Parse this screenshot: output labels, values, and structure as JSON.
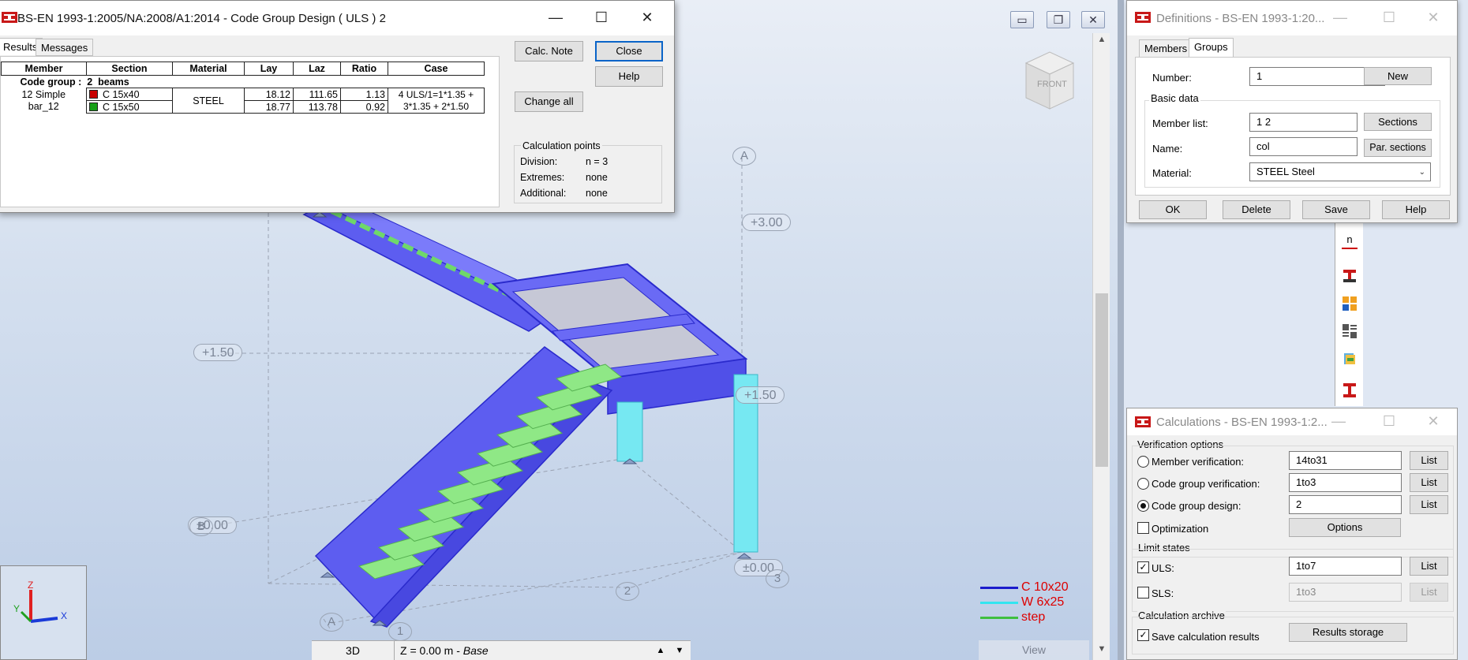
{
  "viewport": {
    "level_labels": [
      "+3.00",
      "+1.50",
      "+1.50",
      "±0.00",
      "±0.00"
    ],
    "grid_labels": [
      "A",
      "A",
      "1",
      "2",
      "3",
      "B"
    ],
    "nav_cube_label": "FRONT",
    "controls": {
      "minimize": "▭",
      "restore": "❐",
      "close": "✕"
    },
    "bottom_bar": {
      "mode": "3D",
      "level_text": "Z = 0.00 m - ",
      "level_name": "Base",
      "up": "▲",
      "down": "▼"
    },
    "view_button": "View",
    "axes": {
      "z": "Z",
      "y": "Y",
      "x": "X"
    },
    "legend": [
      {
        "label": "C 10x20",
        "color": "#1b1bcc"
      },
      {
        "label": "W 6x25",
        "color": "#33e5f0"
      },
      {
        "label": "step",
        "color": "#3fbf3f"
      }
    ],
    "colors": {
      "frame": "#6060f0",
      "step": "#8fe886",
      "column": "#6ee8f2",
      "slab": "#c8cad8"
    }
  },
  "code_group_dialog": {
    "title": "BS-EN 1993-1:2005/NA:2008/A1:2014 - Code Group Design ( ULS ) 2",
    "tabs": [
      "Results",
      "Messages"
    ],
    "columns": [
      "Member",
      "Section",
      "Material",
      "Lay",
      "Laz",
      "Ratio",
      "Case"
    ],
    "group_label": "Code group :",
    "group_number": "2",
    "group_name": "beams",
    "member": {
      "line1": "12  Simple",
      "line2": "bar_12"
    },
    "material": "STEEL",
    "rows": [
      {
        "section": "C 15x40",
        "lay": "18.12",
        "laz": "111.65",
        "ratio": "1.13",
        "status_color": "#c80000"
      },
      {
        "section": "C 15x50",
        "lay": "18.77",
        "laz": "113.78",
        "ratio": "0.92",
        "status_color": "#18a018"
      }
    ],
    "case": {
      "line1": "4 ULS/1=1*1.35 +",
      "line2": "3*1.35 + 2*1.50"
    },
    "buttons": {
      "calc_note": "Calc. Note",
      "close": "Close",
      "help": "Help",
      "change_all": "Change all"
    },
    "calc_points": {
      "title": "Calculation points",
      "division_label": "Division:",
      "division_value": "n = 3",
      "extremes_label": "Extremes:",
      "extremes_value": "none",
      "additional_label": "Additional:",
      "additional_value": "none"
    }
  },
  "definitions_dialog": {
    "title": "Definitions - BS-EN 1993-1:20...",
    "tabs": [
      "Members",
      "Groups"
    ],
    "number_label": "Number:",
    "number_value": "1",
    "new_button": "New",
    "basic_data": "Basic data",
    "member_list_label": "Member list:",
    "member_list_value": "1 2",
    "sections_button": "Sections",
    "name_label": "Name:",
    "name_value": "col",
    "par_sections_button": "Par. sections",
    "material_label": "Material:",
    "material_value": "STEEL Steel",
    "buttons": {
      "ok": "OK",
      "delete": "Delete",
      "save": "Save",
      "help": "Help"
    }
  },
  "calculations_dialog": {
    "title": "Calculations - BS-EN 1993-1:2...",
    "verification_options": "Verification options",
    "member_verification": {
      "label": "Member verification:",
      "value": "14to31",
      "list": "List",
      "selected": false
    },
    "code_group_verification": {
      "label": "Code group verification:",
      "value": "1to3",
      "list": "List",
      "selected": false
    },
    "code_group_design": {
      "label": "Code group design:",
      "value": "2",
      "list": "List",
      "selected": true
    },
    "optimization": {
      "label": "Optimization",
      "checked": false,
      "options_button": "Options"
    },
    "limit_states": "Limit states",
    "uls": {
      "label": "ULS:",
      "value": "1to7",
      "list": "List",
      "checked": true
    },
    "sls": {
      "label": "SLS:",
      "value": "1to3",
      "list": "List",
      "checked": false
    },
    "calculation_archive": "Calculation archive",
    "save_results": {
      "label": "Save calculation results",
      "checked": true
    },
    "results_storage_button": "Results storage"
  },
  "toolstrip": {
    "icon_text_n": "n"
  }
}
